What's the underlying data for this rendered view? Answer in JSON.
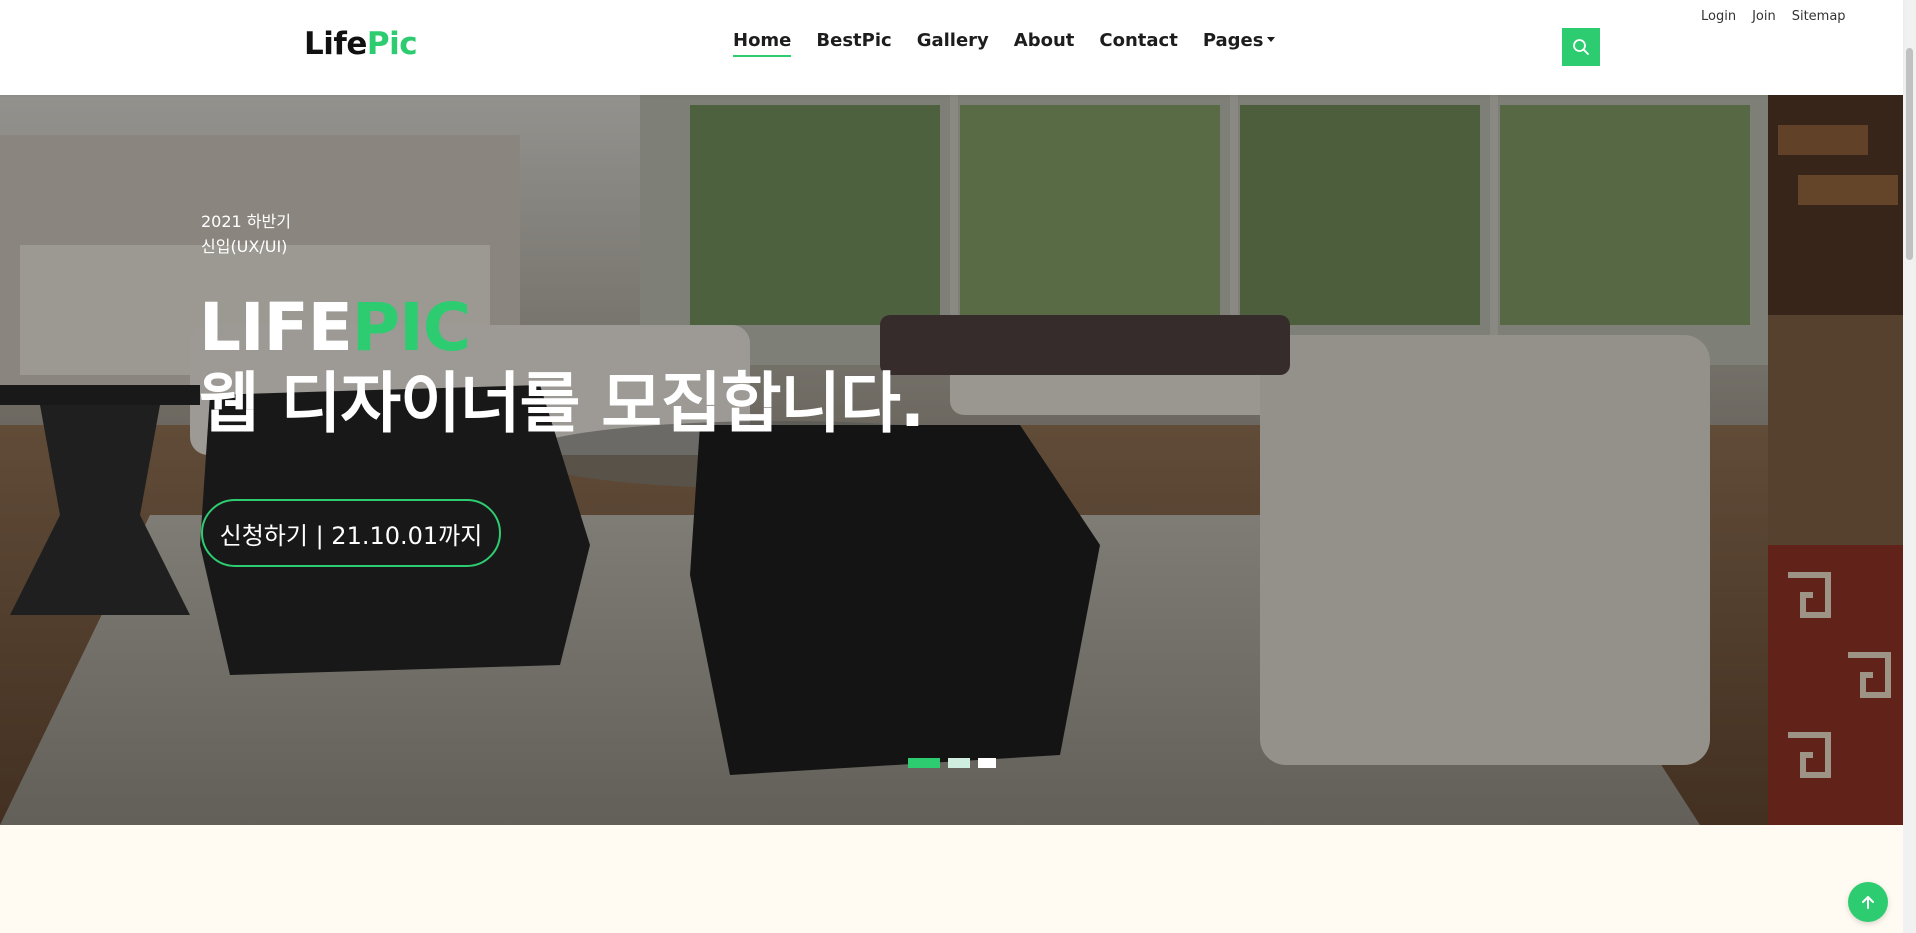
{
  "colors": {
    "accent": "#2ecc71",
    "text_dark": "#1d1d1d",
    "below_bg": "#fffaf2"
  },
  "header": {
    "logo": {
      "part1": "Life",
      "part2": "Pic"
    },
    "nav": [
      {
        "label": "Home",
        "active": true
      },
      {
        "label": "BestPic"
      },
      {
        "label": "Gallery"
      },
      {
        "label": "About"
      },
      {
        "label": "Contact"
      },
      {
        "label": "Pages",
        "has_dropdown": true
      }
    ],
    "search_icon": "search-icon",
    "top_links": [
      "Login",
      "Join",
      "Sitemap"
    ]
  },
  "hero": {
    "sub_line1": "2021 하반기",
    "sub_line2": "신입(UX/UI)",
    "brand_part1": "LIFE",
    "brand_part2": "PIC",
    "title": "웹 디자이너를 모집합니다.",
    "button": "신청하기 | 21.10.01까지",
    "slides": 3,
    "active_slide": 1
  },
  "scroll_top_icon": "arrow-up-icon"
}
